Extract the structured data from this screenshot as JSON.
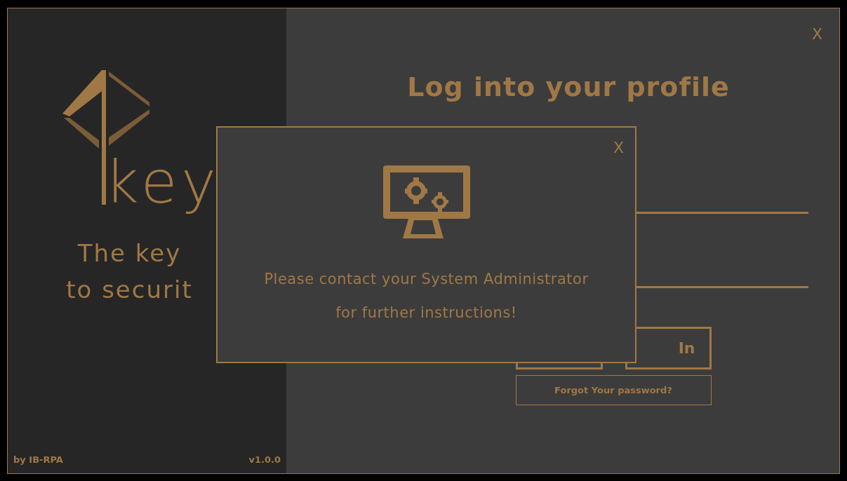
{
  "brand": {
    "logo_text": "key",
    "tagline": [
      "The key",
      "to securit"
    ],
    "author": "by IB-RPA",
    "version": "v1.0.0"
  },
  "login": {
    "close": "X",
    "title": "Log into your profile",
    "login_button": "In",
    "forgot_button": "Forgot Your password?"
  },
  "dialog": {
    "close": "X",
    "message": [
      "Please contact your System Administrator",
      "for further instructions!"
    ]
  }
}
